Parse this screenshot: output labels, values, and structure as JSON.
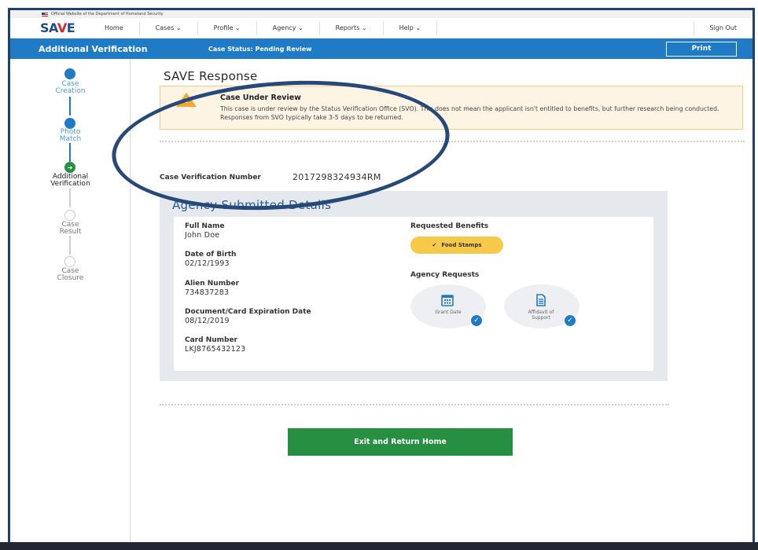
{
  "gov_banner": "Official Website of the Department of Homeland Security",
  "logo": {
    "prefix": "SA",
    "mark": "V",
    "suffix": "E"
  },
  "nav": {
    "items": [
      "Home",
      "Cases ⌄",
      "Profile ⌄",
      "Agency ⌄",
      "Reports ⌄",
      "Help ⌄"
    ],
    "sign_out": "Sign Out"
  },
  "header": {
    "title": "Additional Verification",
    "case_status": "Case Status: Pending Review",
    "print_label": "Print"
  },
  "steps": [
    {
      "line1": "Case",
      "line2": "Creation",
      "state": "done"
    },
    {
      "line1": "Photo",
      "line2": "Match",
      "state": "done"
    },
    {
      "line1": "Additional",
      "line2": "Verification",
      "state": "current"
    },
    {
      "line1": "Case",
      "line2": "Result",
      "state": "pending"
    },
    {
      "line1": "Case",
      "line2": "Closure",
      "state": "pending"
    }
  ],
  "response": {
    "heading": "SAVE Response",
    "alert_title": "Case Under Review",
    "alert_text": "This case is under review by the Status Verification Office (SVO). This does not mean the applicant isn't entitled to benefits, but further research being conducted. Responses from SVO typically take 3-5 days to be returned."
  },
  "case_verification": {
    "label": "Case Verification Number",
    "value": "2017298324934RM"
  },
  "agency_details": {
    "title": "Agency Submitted Details",
    "fields": [
      {
        "label": "Full Name",
        "value": "John Doe"
      },
      {
        "label": "Date of Birth",
        "value": "02/12/1993"
      },
      {
        "label": "Alien Number",
        "value": "734837283"
      },
      {
        "label": "Document/Card Expiration Date",
        "value": "08/12/2019"
      },
      {
        "label": "Card Number",
        "value": "LKJ8765432123"
      }
    ],
    "requested_benefits_label": "Requested Benefits",
    "benefit": "Food Stamps",
    "agency_requests_label": "Agency Requests",
    "requests": [
      {
        "label": "Grant Date",
        "icon": "calendar-icon"
      },
      {
        "label": "Affidavit of Support",
        "icon": "document-icon"
      }
    ]
  },
  "exit_label": "Exit and Return Home",
  "colors": {
    "primary_blue": "#1f7bc6",
    "success_green": "#278f42",
    "warning": "#f0a830",
    "pill_yellow": "#f8c84a"
  }
}
